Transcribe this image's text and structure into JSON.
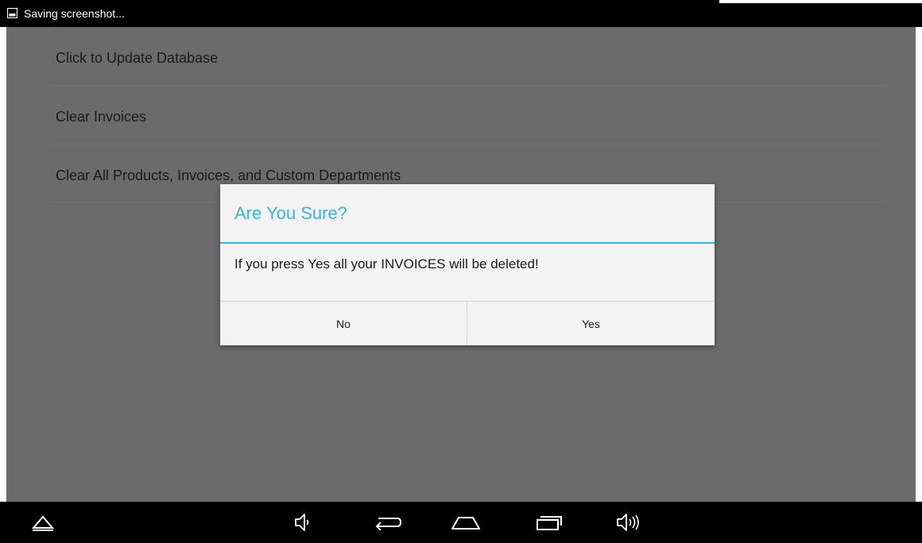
{
  "status_bar": {
    "notification_icon": "screenshot-icon",
    "text": "Saving screenshot..."
  },
  "menu": {
    "items": [
      {
        "label": "Click to Update Database"
      },
      {
        "label": "Clear Invoices"
      },
      {
        "label": "Clear All Products, Invoices, and Custom Departments"
      }
    ]
  },
  "dialog": {
    "title": "Are You Sure?",
    "message": "If you press Yes all your INVOICES will be deleted!",
    "buttons": {
      "no": "No",
      "yes": "Yes"
    }
  },
  "nav_bar": {
    "icons": [
      "menu-up-icon",
      "volume-down-icon",
      "back-icon",
      "home-icon",
      "recent-apps-icon",
      "volume-up-icon"
    ]
  },
  "colors": {
    "accent": "#33b5e5",
    "dim_background": "#6b6b6b",
    "dialog_background": "#f3f3f3"
  }
}
